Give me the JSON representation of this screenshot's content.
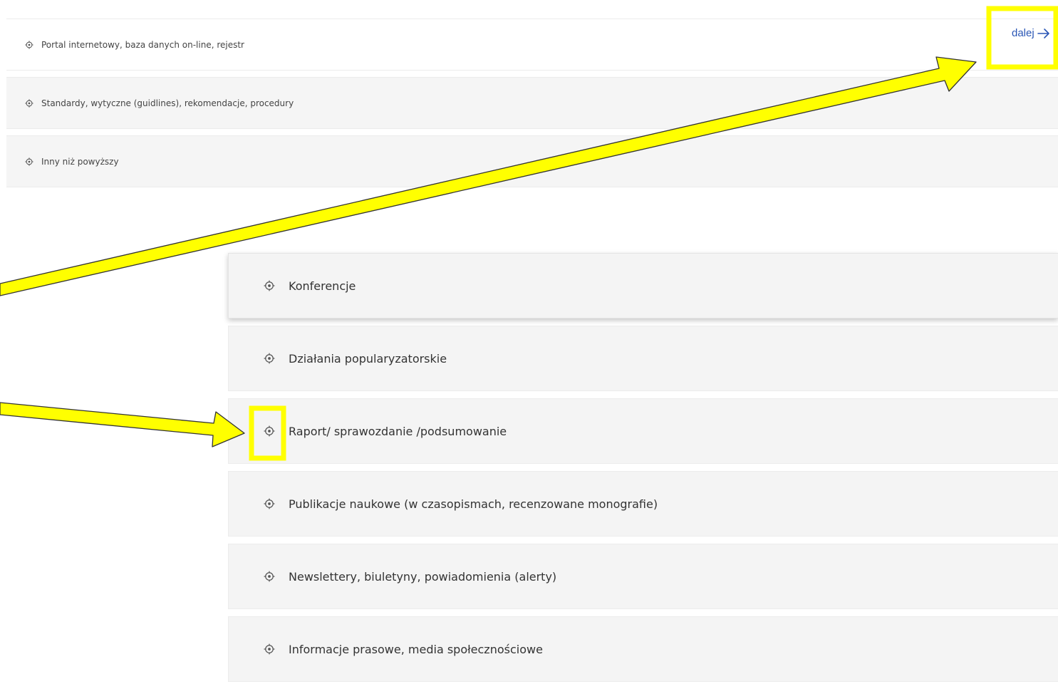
{
  "top_list": {
    "items": [
      {
        "label": "Portal internetowy, baza danych on-line, rejestr",
        "icon": "target-icon"
      },
      {
        "label": "Standardy, wytyczne (guidlines), rekomendacje, procedury",
        "icon": "target-icon"
      },
      {
        "label": "Inny niż powyższy",
        "icon": "target-icon"
      }
    ]
  },
  "next_link": {
    "label": "dalej",
    "icon": "arrow-right-icon",
    "color": "#2a56b5"
  },
  "big_list": {
    "items": [
      {
        "label": "Konferencje",
        "icon": "target-icon"
      },
      {
        "label": "Działania popularyzatorskie",
        "icon": "target-icon"
      },
      {
        "label": "Raport/ sprawozdanie /podsumowanie",
        "icon": "target-icon"
      },
      {
        "label": "Publikacje naukowe (w czasopismach, recenzowane monografie)",
        "icon": "target-icon"
      },
      {
        "label": "Newslettery, biuletyny, powiadomienia (alerty)",
        "icon": "target-icon"
      },
      {
        "label": "Informacje prasowe, media społecznościowe",
        "icon": "target-icon"
      }
    ]
  },
  "annotation": {
    "highlight_color": "#ffff00",
    "outline_color": "#222222"
  }
}
